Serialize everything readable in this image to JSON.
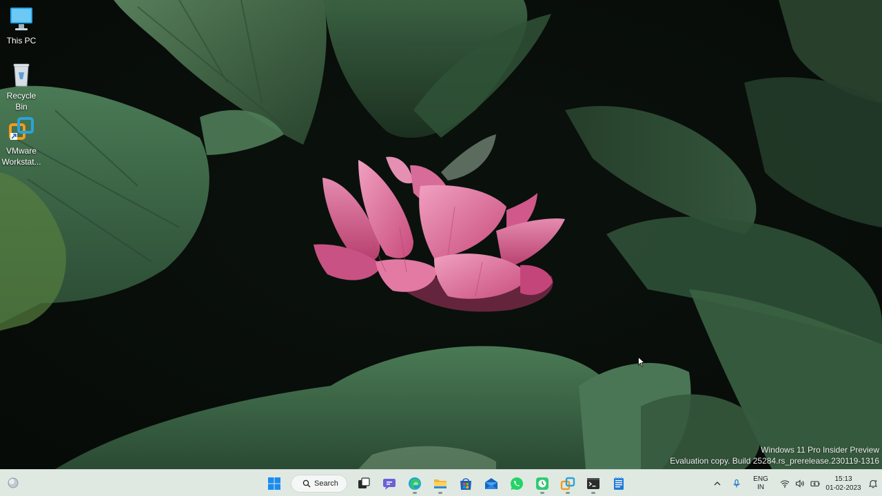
{
  "desktop": {
    "icons": [
      {
        "name": "this-pc",
        "label": "This PC",
        "icon": "monitor-icon"
      },
      {
        "name": "recycle-bin",
        "label": "Recycle Bin",
        "icon": "recycle-bin-icon"
      },
      {
        "name": "vmware-workstation",
        "label": "VMware Workstat...",
        "icon": "vmware-icon"
      }
    ]
  },
  "watermark": {
    "line1": "Windows 11 Pro Insider Preview",
    "line2": "Evaluation copy. Build 25284.rs_prerelease.230119-1316"
  },
  "taskbar": {
    "search_label": "Search",
    "apps": [
      "start-icon",
      "search",
      "task-view-icon",
      "teams-chat-icon",
      "edge-icon",
      "file-explorer-icon",
      "microsoft-store-icon",
      "mail-icon",
      "whatsapp-icon",
      "clock-app-icon",
      "vmware-icon",
      "terminal-icon",
      "notepad-icon"
    ],
    "tray": {
      "language_top": "ENG",
      "language_bottom": "IN",
      "time": "15:13",
      "date": "01-02-2023"
    }
  },
  "colors": {
    "taskbar_bg": "#dfe9e2",
    "accent": "#0078d4",
    "lotus": "#d9648f"
  }
}
